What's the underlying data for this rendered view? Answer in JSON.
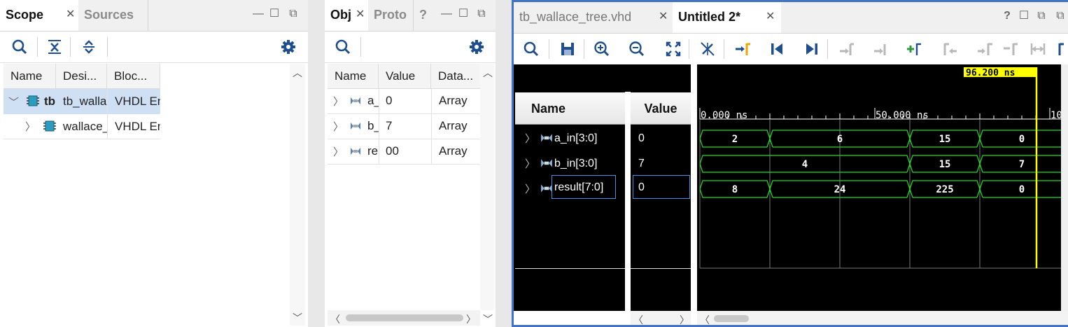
{
  "scope_panel": {
    "tabs": [
      "Scope",
      "Sources"
    ],
    "columns": [
      "Name",
      "Desi...",
      "Bloc..."
    ],
    "rows": [
      {
        "name": "tb",
        "design": "tb_walla",
        "block": "VHDL En"
      },
      {
        "name": "",
        "design": "wallace_",
        "block": "VHDL En"
      }
    ]
  },
  "objects_panel": {
    "tabs": [
      "Obj",
      "Proto",
      "?"
    ],
    "columns": [
      "Name",
      "Value",
      "Data..."
    ],
    "rows": [
      {
        "name": "a_",
        "value": "0",
        "type": "Array"
      },
      {
        "name": "b_",
        "value": "7",
        "type": "Array"
      },
      {
        "name": "re",
        "value": "00",
        "type": "Array"
      }
    ]
  },
  "wave_panel": {
    "tabs": [
      "tb_wallace_tree.vhd",
      "Untitled 2*"
    ],
    "name_header": "Name",
    "value_header": "Value",
    "signals": [
      {
        "name": "a_in[3:0]",
        "value": "0"
      },
      {
        "name": "b_in[3:0]",
        "value": "7"
      },
      {
        "name": "result[7:0]",
        "value": "0"
      }
    ],
    "cursor_label": "96.200 ns",
    "time_labels": [
      "0.000 ns",
      "50.000 ns",
      "10"
    ],
    "waves": [
      [
        "2",
        "6",
        "15",
        "0"
      ],
      [
        "4",
        "15",
        "7"
      ],
      [
        "8",
        "24",
        "225",
        "0"
      ]
    ],
    "colors": {
      "wave": "#22dd22",
      "cursor": "#ffff00",
      "accent": "#4472c4"
    }
  },
  "icons": [
    "search-icon",
    "collapse-all-icon",
    "expand-all-icon",
    "gear-icon",
    "save-icon",
    "zoom-in-icon",
    "zoom-out-icon",
    "zoom-fit-icon",
    "go-to-cursor-icon",
    "go-to-start-icon",
    "go-to-end-icon",
    "add-marker-icon"
  ]
}
